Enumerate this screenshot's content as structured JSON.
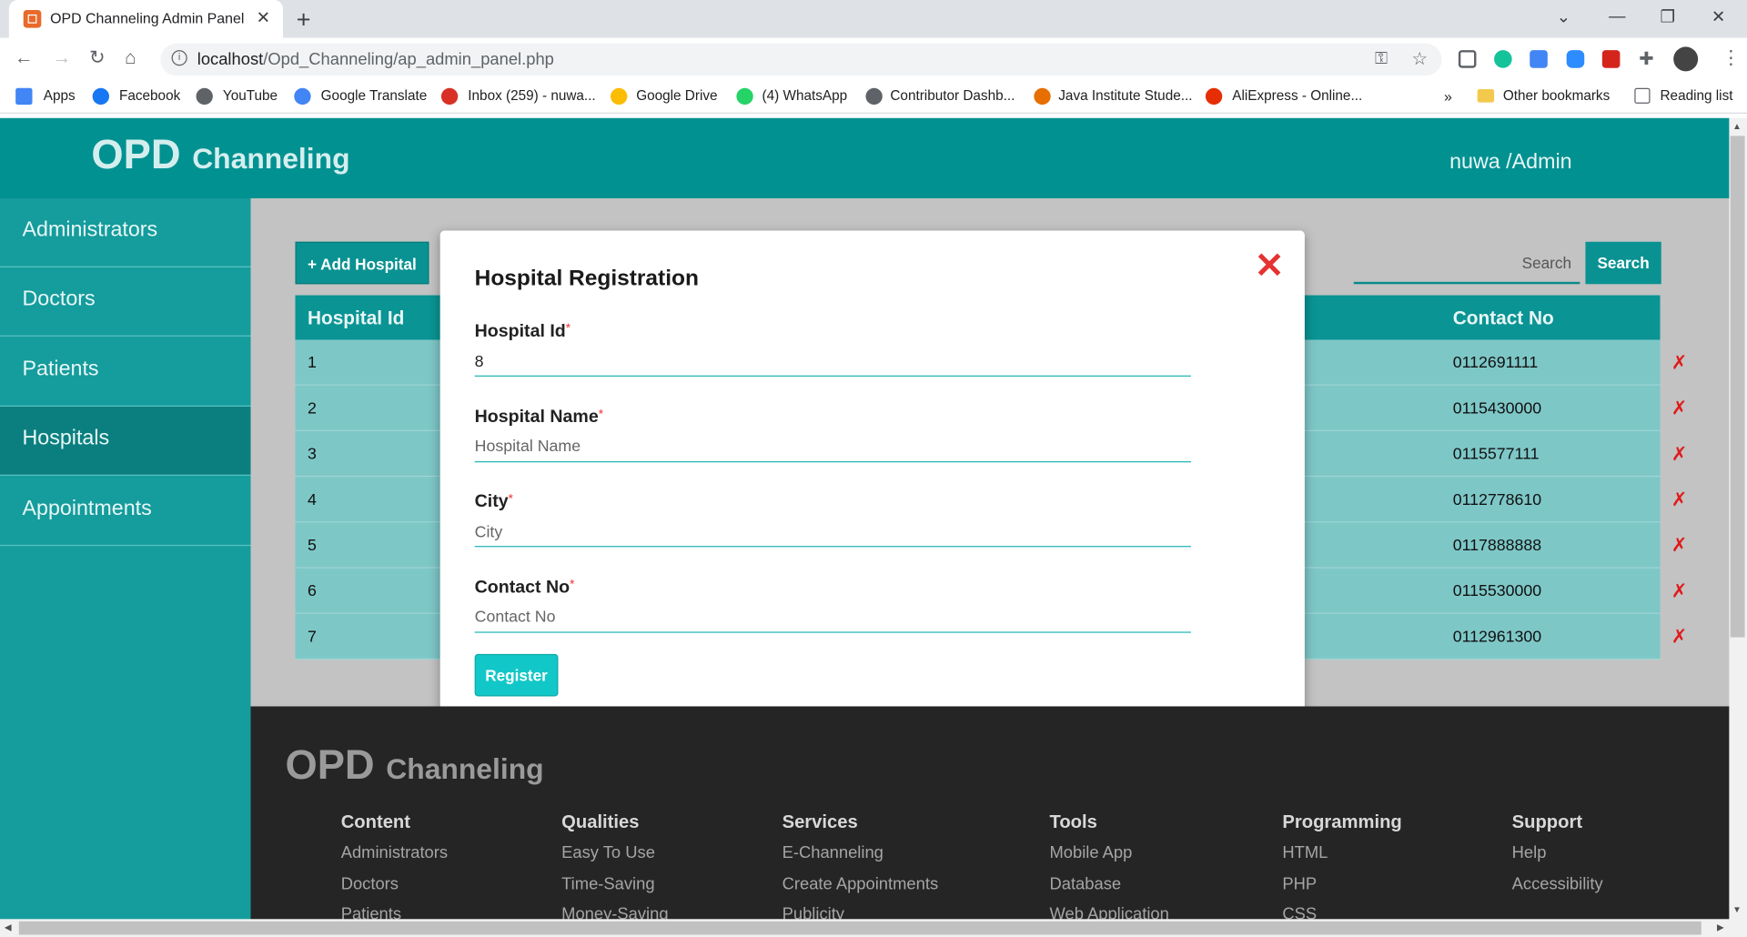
{
  "browser": {
    "tab_title": "OPD Channeling Admin Panel",
    "url_host": "localhost",
    "url_path": "/Opd_Channeling/ap_admin_panel.php",
    "bookmarks": [
      {
        "label": "Apps",
        "icon": "apps-grid-icon",
        "color": "#4285f4"
      },
      {
        "label": "Facebook",
        "icon": "facebook-icon",
        "color": "#1877f2"
      },
      {
        "label": "YouTube",
        "icon": "globe-icon",
        "color": "#5f6368"
      },
      {
        "label": "Google Translate",
        "icon": "translate-icon",
        "color": "#4285f4"
      },
      {
        "label": "Inbox (259) - nuwa...",
        "icon": "gmail-icon",
        "color": "#d93025"
      },
      {
        "label": "Google Drive",
        "icon": "drive-icon",
        "color": "#fbbc04"
      },
      {
        "label": "(4) WhatsApp",
        "icon": "whatsapp-icon",
        "color": "#25d366"
      },
      {
        "label": "Contributor Dashb...",
        "icon": "globe-icon",
        "color": "#5f6368"
      },
      {
        "label": "Java Institute Stude...",
        "icon": "java-icon",
        "color": "#e76f00"
      },
      {
        "label": "AliExpress - Online...",
        "icon": "aliexpress-icon",
        "color": "#e62e04"
      }
    ],
    "more_bookmarks": "»",
    "other_bookmarks": "Other bookmarks",
    "reading_list": "Reading list"
  },
  "header": {
    "logo_big": "OPD",
    "logo_small": "Channeling",
    "user": "nuwa /Admin"
  },
  "sidebar": {
    "items": [
      {
        "label": "Administrators",
        "active": false
      },
      {
        "label": "Doctors",
        "active": false
      },
      {
        "label": "Patients",
        "active": false
      },
      {
        "label": "Hospitals",
        "active": true
      },
      {
        "label": "Appointments",
        "active": false
      }
    ]
  },
  "main": {
    "add_button": "+ Add Hospital",
    "search_placeholder": "Search",
    "search_button": "Search",
    "table": {
      "col_id": "Hospital Id",
      "col_contact": "Contact No",
      "rows": [
        {
          "id": "1",
          "contact": "0112691111"
        },
        {
          "id": "2",
          "contact": "0115430000"
        },
        {
          "id": "3",
          "contact": "0115577111"
        },
        {
          "id": "4",
          "contact": "0112778610"
        },
        {
          "id": "5",
          "contact": "0117888888"
        },
        {
          "id": "6",
          "contact": "0115530000"
        },
        {
          "id": "7",
          "contact": "0112961300"
        }
      ],
      "delete_symbol": "✗"
    }
  },
  "modal": {
    "title": "Hospital Registration",
    "close_symbol": "✕",
    "required_mark": "*",
    "fields": [
      {
        "label": "Hospital Id",
        "value": "8",
        "placeholder": ""
      },
      {
        "label": "Hospital Name",
        "value": "",
        "placeholder": "Hospital Name"
      },
      {
        "label": "City",
        "value": "",
        "placeholder": "City"
      },
      {
        "label": "Contact No",
        "value": "",
        "placeholder": "Contact No"
      }
    ],
    "submit": "Register"
  },
  "footer": {
    "logo_big": "OPD",
    "logo_small": "Channeling",
    "columns": [
      {
        "heading": "Content",
        "links": [
          "Administrators",
          "Doctors",
          "Patients"
        ]
      },
      {
        "heading": "Qualities",
        "links": [
          "Easy To Use",
          "Time-Saving",
          "Money-Saving"
        ]
      },
      {
        "heading": "Services",
        "links": [
          "E-Channeling",
          "Create Appointments",
          "Publicity"
        ]
      },
      {
        "heading": "Tools",
        "links": [
          "Mobile App",
          "Database",
          "Web Application"
        ]
      },
      {
        "heading": "Programming",
        "links": [
          "HTML",
          "PHP",
          "CSS"
        ]
      },
      {
        "heading": "Support",
        "links": [
          "Help",
          "Accessibility"
        ]
      }
    ]
  }
}
